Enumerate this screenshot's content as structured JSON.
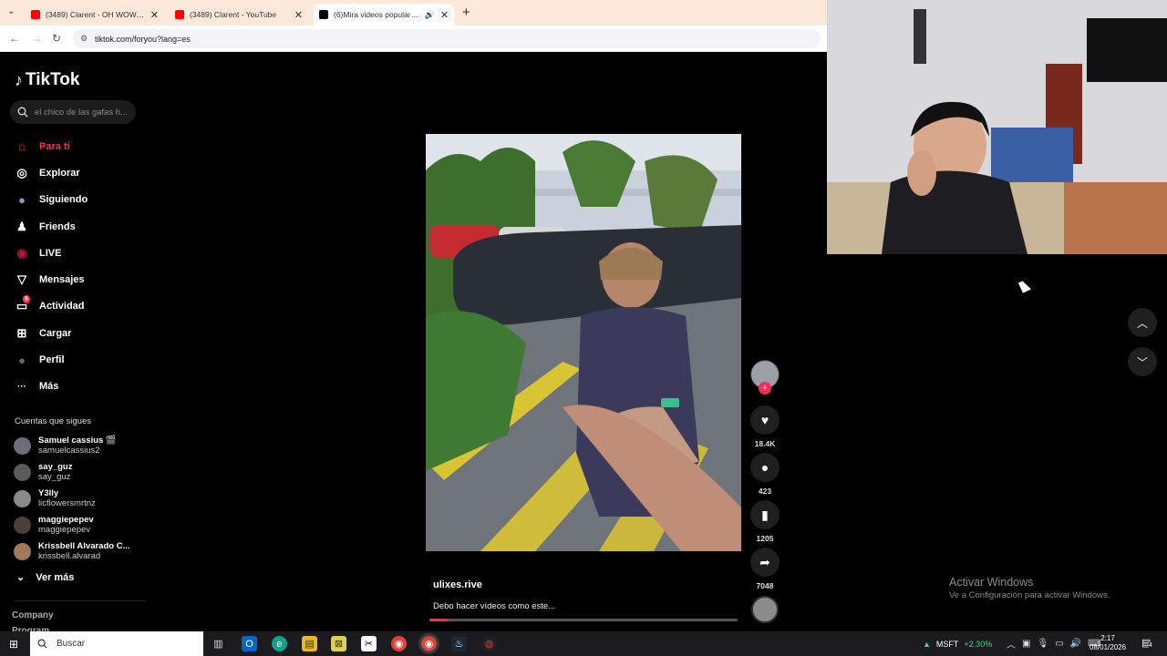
{
  "browser": {
    "tabs": [
      {
        "title": "(3489) Clarent - OH WOW (Vid",
        "icon": "youtube-icon",
        "color": "#ff0000"
      },
      {
        "title": "(3489) Clarent - YouTube",
        "icon": "youtube-icon",
        "color": "#ff0000"
      },
      {
        "title": "(6)Mira videos populares s",
        "icon": "tiktok-icon",
        "color": "#000000"
      }
    ],
    "new_tab": "+",
    "url": "tiktok.com/foryou?lang=es"
  },
  "sidebar": {
    "logo": "TikTok",
    "search_placeholder": "el chico de las gafas h...",
    "menu": [
      {
        "label": "Para ti",
        "icon": "home-icon",
        "glyph": "⌂"
      },
      {
        "label": "Explorar",
        "icon": "compass-icon",
        "glyph": "◎"
      },
      {
        "label": "Siguiendo",
        "icon": "following-avatar-icon",
        "glyph": "●"
      },
      {
        "label": "Friends",
        "icon": "friends-icon",
        "glyph": "♟"
      },
      {
        "label": "LIVE",
        "icon": "live-icon",
        "glyph": "◉"
      },
      {
        "label": "Mensajes",
        "icon": "send-icon",
        "glyph": "▽"
      },
      {
        "label": "Actividad",
        "icon": "inbox-icon",
        "glyph": "▭",
        "badge": "6"
      },
      {
        "label": "Cargar",
        "icon": "upload-icon",
        "glyph": "⊞"
      },
      {
        "label": "Perfil",
        "icon": "profile-avatar-icon",
        "glyph": "●"
      },
      {
        "label": "Más",
        "icon": "more-icon",
        "glyph": "···"
      }
    ],
    "following_title": "Cuentas que sigues",
    "accounts": [
      {
        "name": "Samuel cassius 🎬",
        "handle": "samuelcassius2"
      },
      {
        "name": "say_guz",
        "handle": "say_guz"
      },
      {
        "name": "Y3lly",
        "handle": "licflowersmrtnz"
      },
      {
        "name": "maggiepepev",
        "handle": "maggiepepev"
      },
      {
        "name": "Krissbell Alvarado C...",
        "handle": "krissbell.alvarad"
      }
    ],
    "see_more": "Ver más",
    "company": "Company",
    "program": "Program"
  },
  "video": {
    "author": "ulixes.rive",
    "caption": "Debo hacer vídeos como este...",
    "progress": 0.06,
    "likes": "18.4K",
    "comments": "423",
    "saves": "1205",
    "shares": "7048"
  },
  "watermark": {
    "line1": "Activar Windows",
    "line2": "Ve a Configuración para activar Windows."
  },
  "taskbar": {
    "search": "Buscar",
    "stock_symbol": "MSFT",
    "stock_change": "+2.30%",
    "time": "2:17",
    "date": "08/01/2026",
    "notifications": "4"
  },
  "colors": {
    "accent": "#fe2c55",
    "stock_up": "#3ddc84"
  }
}
